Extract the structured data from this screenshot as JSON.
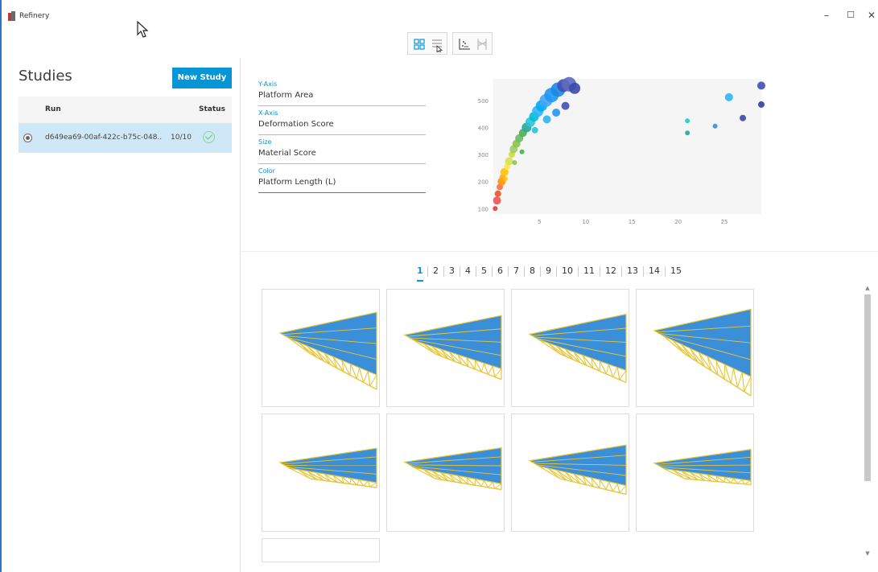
{
  "window": {
    "title": "Refinery",
    "controls": {
      "minimize": "–",
      "maximize": "☐",
      "close": "✕"
    }
  },
  "toolbar": {
    "icons": [
      "grid-view-icon",
      "list-view-icon",
      "scatter-plot-icon",
      "parallel-coordinates-icon"
    ]
  },
  "studies": {
    "title": "Studies",
    "new_study_label": "New Study",
    "columns": {
      "run": "Run",
      "status": "Status"
    },
    "rows": [
      {
        "id": "d649ea69-00af-422c-b75c-048..",
        "count": "10/10",
        "status": "complete"
      }
    ]
  },
  "axes_config": {
    "y_axis": {
      "label": "Y-Axis",
      "value": "Platform Area"
    },
    "x_axis": {
      "label": "X-Axis",
      "value": "Deformation Score"
    },
    "size": {
      "label": "Size",
      "value": "Material Score"
    },
    "color": {
      "label": "Color",
      "value": "Platform Length (L)"
    }
  },
  "chart_data": {
    "type": "scatter",
    "title": "",
    "xlabel": "",
    "ylabel": "",
    "xlim": [
      0,
      29
    ],
    "ylim": [
      80,
      580
    ],
    "xticks": [
      "5",
      "10",
      "15",
      "20",
      "25"
    ],
    "yticks": [
      "100",
      "200",
      "300",
      "400",
      "500"
    ],
    "grid": false,
    "points": [
      {
        "x": 0.2,
        "y": 100,
        "s": 3,
        "c": "#e53935"
      },
      {
        "x": 0.4,
        "y": 130,
        "s": 5,
        "c": "#ef5350"
      },
      {
        "x": 0.5,
        "y": 155,
        "s": 4,
        "c": "#f4511e"
      },
      {
        "x": 0.7,
        "y": 180,
        "s": 4,
        "c": "#ff7043"
      },
      {
        "x": 0.9,
        "y": 200,
        "s": 5,
        "c": "#ff9800"
      },
      {
        "x": 1.0,
        "y": 215,
        "s": 4,
        "c": "#ffa726"
      },
      {
        "x": 1.2,
        "y": 235,
        "s": 5,
        "c": "#ffc107"
      },
      {
        "x": 1.5,
        "y": 255,
        "s": 4,
        "c": "#ffeb3b"
      },
      {
        "x": 1.7,
        "y": 275,
        "s": 5,
        "c": "#d4e157"
      },
      {
        "x": 2.0,
        "y": 300,
        "s": 4,
        "c": "#cddc39"
      },
      {
        "x": 2.2,
        "y": 320,
        "s": 5,
        "c": "#9ccc65"
      },
      {
        "x": 2.5,
        "y": 340,
        "s": 5,
        "c": "#8bc34a"
      },
      {
        "x": 2.8,
        "y": 360,
        "s": 5,
        "c": "#66bb6a"
      },
      {
        "x": 3.2,
        "y": 380,
        "s": 5,
        "c": "#4caf50"
      },
      {
        "x": 3.6,
        "y": 400,
        "s": 6,
        "c": "#26a69a"
      },
      {
        "x": 4.0,
        "y": 420,
        "s": 6,
        "c": "#26c6da"
      },
      {
        "x": 4.4,
        "y": 440,
        "s": 6,
        "c": "#00bcd4"
      },
      {
        "x": 4.8,
        "y": 460,
        "s": 7,
        "c": "#29b6f6"
      },
      {
        "x": 5.2,
        "y": 480,
        "s": 7,
        "c": "#03a9f4"
      },
      {
        "x": 5.7,
        "y": 500,
        "s": 8,
        "c": "#42a5f5"
      },
      {
        "x": 6.3,
        "y": 520,
        "s": 9,
        "c": "#2196f3"
      },
      {
        "x": 7.0,
        "y": 540,
        "s": 9,
        "c": "#1e88e5"
      },
      {
        "x": 7.6,
        "y": 555,
        "s": 8,
        "c": "#3f51b5"
      },
      {
        "x": 8.2,
        "y": 560,
        "s": 9,
        "c": "#5c6bc0"
      },
      {
        "x": 8.8,
        "y": 545,
        "s": 7,
        "c": "#3949ab"
      },
      {
        "x": 1.3,
        "y": 210,
        "s": 3,
        "c": "#ffc107"
      },
      {
        "x": 2.3,
        "y": 270,
        "s": 3,
        "c": "#8bc34a"
      },
      {
        "x": 3.1,
        "y": 310,
        "s": 3,
        "c": "#4caf50"
      },
      {
        "x": 4.5,
        "y": 390,
        "s": 4,
        "c": "#26c6da"
      },
      {
        "x": 5.8,
        "y": 430,
        "s": 5,
        "c": "#29b6f6"
      },
      {
        "x": 6.8,
        "y": 455,
        "s": 5,
        "c": "#2196f3"
      },
      {
        "x": 7.8,
        "y": 480,
        "s": 5,
        "c": "#3f51b5"
      },
      {
        "x": 21,
        "y": 425,
        "s": 3,
        "c": "#26c6da"
      },
      {
        "x": 21,
        "y": 380,
        "s": 3,
        "c": "#26a69a"
      },
      {
        "x": 24,
        "y": 405,
        "s": 3,
        "c": "#3f8be0"
      },
      {
        "x": 25.5,
        "y": 512,
        "s": 5,
        "c": "#29b6f6"
      },
      {
        "x": 27,
        "y": 435,
        "s": 4,
        "c": "#3949ab"
      },
      {
        "x": 29,
        "y": 555,
        "s": 5,
        "c": "#3f51b5"
      },
      {
        "x": 29,
        "y": 485,
        "s": 4,
        "c": "#303f9f"
      }
    ]
  },
  "pagination": {
    "pages": [
      "1",
      "2",
      "3",
      "4",
      "5",
      "6",
      "7",
      "8",
      "9",
      "10",
      "11",
      "12",
      "13",
      "14",
      "15"
    ],
    "current": "1"
  },
  "gallery": {
    "thumbnails": [
      {
        "name": "design-1"
      },
      {
        "name": "design-2"
      },
      {
        "name": "design-3"
      },
      {
        "name": "design-4"
      },
      {
        "name": "design-5"
      },
      {
        "name": "design-6"
      },
      {
        "name": "design-7"
      },
      {
        "name": "design-8"
      },
      {
        "name": "design-9"
      }
    ]
  },
  "colors": {
    "accent": "#0696d7",
    "selection": "#cfe8f8",
    "platform": "#3b8fd8",
    "truss": "#e8c63a"
  }
}
